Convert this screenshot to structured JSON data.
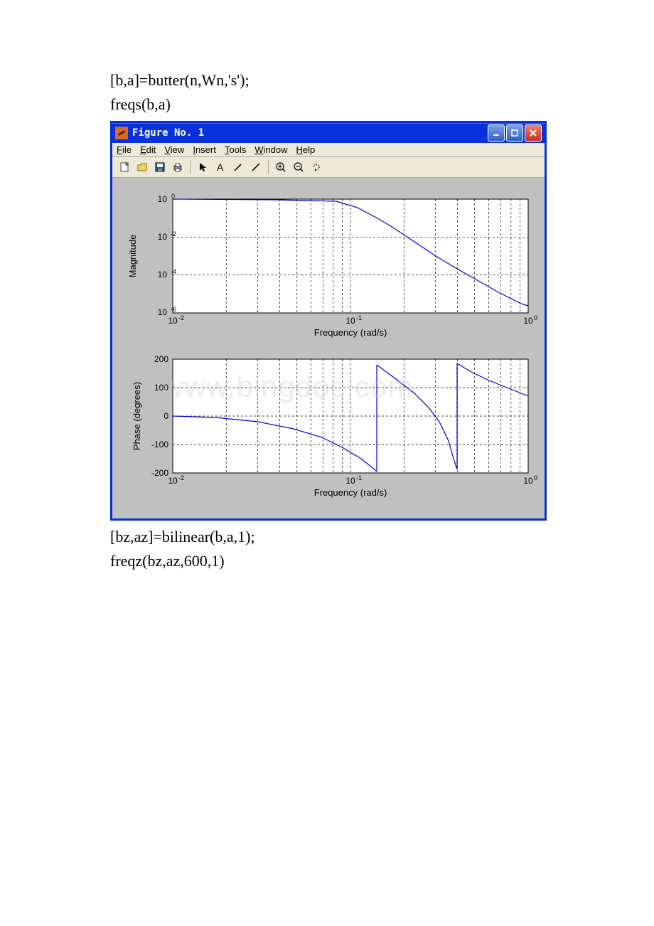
{
  "code_before": [
    " [b,a]=butter(n,Wn,'s');",
    "freqs(b,a)"
  ],
  "code_after": [
    "[bz,az]=bilinear(b,a,1);",
    "freqz(bz,az,600,1)"
  ],
  "window": {
    "title": "Figure No. 1"
  },
  "menu": {
    "file": "File",
    "edit": "Edit",
    "view": "View",
    "insert": "Insert",
    "tools": "Tools",
    "window": "Window",
    "help": "Help"
  },
  "chart_data": [
    {
      "type": "line",
      "title": "",
      "xlabel": "Frequency (rad/s)",
      "ylabel": "Magnitude",
      "xscale": "log",
      "yscale": "log",
      "xlim": [
        0.01,
        1.0
      ],
      "ylim": [
        1e-06,
        1.0
      ],
      "xticks": [
        0.01,
        0.1,
        1.0
      ],
      "xtick_labels": [
        "10^-2",
        "10^-1",
        "10^0"
      ],
      "yticks": [
        1e-06,
        0.0001,
        0.01,
        1.0
      ],
      "ytick_labels": [
        "10^-6",
        "10^-4",
        "10^-2",
        "10^0"
      ],
      "series": [
        {
          "name": "Magnitude",
          "x": [
            0.01,
            0.05,
            0.1,
            0.15,
            0.2,
            0.3,
            0.5,
            0.7,
            1.0
          ],
          "y": [
            1.0,
            1.0,
            0.9,
            0.3,
            0.05,
            0.003,
            0.0001,
            1e-05,
            3e-06
          ]
        }
      ]
    },
    {
      "type": "line",
      "title": "",
      "xlabel": "Frequency (rad/s)",
      "ylabel": "Phase (degrees)",
      "xscale": "log",
      "yscale": "linear",
      "xlim": [
        0.01,
        1.0
      ],
      "ylim": [
        -200,
        200
      ],
      "xticks": [
        0.01,
        0.1,
        1.0
      ],
      "xtick_labels": [
        "10^-2",
        "10^-1",
        "10^0"
      ],
      "yticks": [
        -200,
        -100,
        0,
        100,
        200
      ],
      "ytick_labels": [
        "-200",
        "-100",
        "0",
        "100",
        "200"
      ],
      "series": [
        {
          "name": "Phase",
          "x": [
            0.01,
            0.03,
            0.06,
            0.1,
            0.13,
            0.14,
            0.2,
            0.3,
            0.34,
            0.35,
            0.5,
            0.7,
            1.0
          ],
          "y": [
            0,
            -10,
            -35,
            -90,
            -170,
            180,
            120,
            30,
            -160,
            180,
            130,
            95,
            60
          ]
        }
      ]
    }
  ],
  "watermark": "www.bingdoc.com"
}
